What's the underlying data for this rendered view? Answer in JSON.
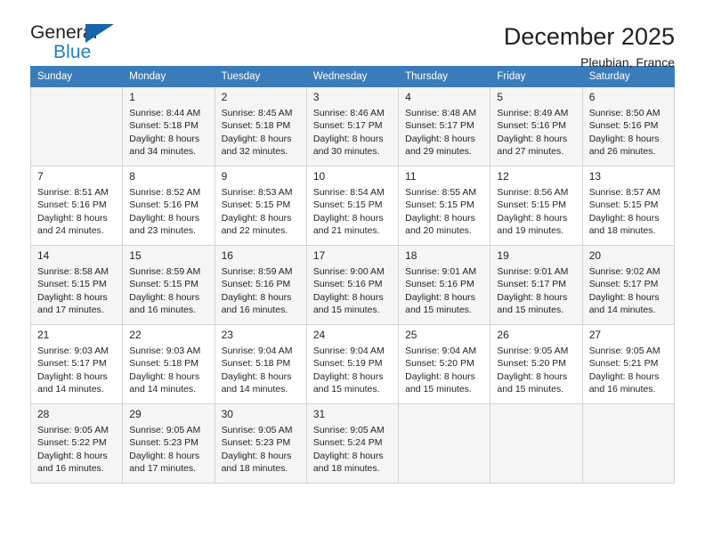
{
  "brand": {
    "name_part1": "General",
    "name_part2": "Blue",
    "triangle_icon": "triangle-icon",
    "accent_color": "#1f7fc4",
    "triangle_color": "#1565a8"
  },
  "header": {
    "title": "December 2025",
    "subtitle": "Pleubian, France"
  },
  "calendar": {
    "header_bg": "#3a7cb9",
    "header_text_color": "#ffffff",
    "shaded_row_bg": "#f5f5f5",
    "weekday_labels": [
      "Sunday",
      "Monday",
      "Tuesday",
      "Wednesday",
      "Thursday",
      "Friday",
      "Saturday"
    ],
    "weeks": [
      {
        "shaded": true,
        "days": [
          {
            "num": "",
            "sunrise": "",
            "sunset": "",
            "daylight_line1": "",
            "daylight_line2": ""
          },
          {
            "num": "1",
            "sunrise": "Sunrise: 8:44 AM",
            "sunset": "Sunset: 5:18 PM",
            "daylight_line1": "Daylight: 8 hours",
            "daylight_line2": "and 34 minutes."
          },
          {
            "num": "2",
            "sunrise": "Sunrise: 8:45 AM",
            "sunset": "Sunset: 5:18 PM",
            "daylight_line1": "Daylight: 8 hours",
            "daylight_line2": "and 32 minutes."
          },
          {
            "num": "3",
            "sunrise": "Sunrise: 8:46 AM",
            "sunset": "Sunset: 5:17 PM",
            "daylight_line1": "Daylight: 8 hours",
            "daylight_line2": "and 30 minutes."
          },
          {
            "num": "4",
            "sunrise": "Sunrise: 8:48 AM",
            "sunset": "Sunset: 5:17 PM",
            "daylight_line1": "Daylight: 8 hours",
            "daylight_line2": "and 29 minutes."
          },
          {
            "num": "5",
            "sunrise": "Sunrise: 8:49 AM",
            "sunset": "Sunset: 5:16 PM",
            "daylight_line1": "Daylight: 8 hours",
            "daylight_line2": "and 27 minutes."
          },
          {
            "num": "6",
            "sunrise": "Sunrise: 8:50 AM",
            "sunset": "Sunset: 5:16 PM",
            "daylight_line1": "Daylight: 8 hours",
            "daylight_line2": "and 26 minutes."
          }
        ]
      },
      {
        "shaded": false,
        "days": [
          {
            "num": "7",
            "sunrise": "Sunrise: 8:51 AM",
            "sunset": "Sunset: 5:16 PM",
            "daylight_line1": "Daylight: 8 hours",
            "daylight_line2": "and 24 minutes."
          },
          {
            "num": "8",
            "sunrise": "Sunrise: 8:52 AM",
            "sunset": "Sunset: 5:16 PM",
            "daylight_line1": "Daylight: 8 hours",
            "daylight_line2": "and 23 minutes."
          },
          {
            "num": "9",
            "sunrise": "Sunrise: 8:53 AM",
            "sunset": "Sunset: 5:15 PM",
            "daylight_line1": "Daylight: 8 hours",
            "daylight_line2": "and 22 minutes."
          },
          {
            "num": "10",
            "sunrise": "Sunrise: 8:54 AM",
            "sunset": "Sunset: 5:15 PM",
            "daylight_line1": "Daylight: 8 hours",
            "daylight_line2": "and 21 minutes."
          },
          {
            "num": "11",
            "sunrise": "Sunrise: 8:55 AM",
            "sunset": "Sunset: 5:15 PM",
            "daylight_line1": "Daylight: 8 hours",
            "daylight_line2": "and 20 minutes."
          },
          {
            "num": "12",
            "sunrise": "Sunrise: 8:56 AM",
            "sunset": "Sunset: 5:15 PM",
            "daylight_line1": "Daylight: 8 hours",
            "daylight_line2": "and 19 minutes."
          },
          {
            "num": "13",
            "sunrise": "Sunrise: 8:57 AM",
            "sunset": "Sunset: 5:15 PM",
            "daylight_line1": "Daylight: 8 hours",
            "daylight_line2": "and 18 minutes."
          }
        ]
      },
      {
        "shaded": true,
        "days": [
          {
            "num": "14",
            "sunrise": "Sunrise: 8:58 AM",
            "sunset": "Sunset: 5:15 PM",
            "daylight_line1": "Daylight: 8 hours",
            "daylight_line2": "and 17 minutes."
          },
          {
            "num": "15",
            "sunrise": "Sunrise: 8:59 AM",
            "sunset": "Sunset: 5:15 PM",
            "daylight_line1": "Daylight: 8 hours",
            "daylight_line2": "and 16 minutes."
          },
          {
            "num": "16",
            "sunrise": "Sunrise: 8:59 AM",
            "sunset": "Sunset: 5:16 PM",
            "daylight_line1": "Daylight: 8 hours",
            "daylight_line2": "and 16 minutes."
          },
          {
            "num": "17",
            "sunrise": "Sunrise: 9:00 AM",
            "sunset": "Sunset: 5:16 PM",
            "daylight_line1": "Daylight: 8 hours",
            "daylight_line2": "and 15 minutes."
          },
          {
            "num": "18",
            "sunrise": "Sunrise: 9:01 AM",
            "sunset": "Sunset: 5:16 PM",
            "daylight_line1": "Daylight: 8 hours",
            "daylight_line2": "and 15 minutes."
          },
          {
            "num": "19",
            "sunrise": "Sunrise: 9:01 AM",
            "sunset": "Sunset: 5:17 PM",
            "daylight_line1": "Daylight: 8 hours",
            "daylight_line2": "and 15 minutes."
          },
          {
            "num": "20",
            "sunrise": "Sunrise: 9:02 AM",
            "sunset": "Sunset: 5:17 PM",
            "daylight_line1": "Daylight: 8 hours",
            "daylight_line2": "and 14 minutes."
          }
        ]
      },
      {
        "shaded": false,
        "days": [
          {
            "num": "21",
            "sunrise": "Sunrise: 9:03 AM",
            "sunset": "Sunset: 5:17 PM",
            "daylight_line1": "Daylight: 8 hours",
            "daylight_line2": "and 14 minutes."
          },
          {
            "num": "22",
            "sunrise": "Sunrise: 9:03 AM",
            "sunset": "Sunset: 5:18 PM",
            "daylight_line1": "Daylight: 8 hours",
            "daylight_line2": "and 14 minutes."
          },
          {
            "num": "23",
            "sunrise": "Sunrise: 9:04 AM",
            "sunset": "Sunset: 5:18 PM",
            "daylight_line1": "Daylight: 8 hours",
            "daylight_line2": "and 14 minutes."
          },
          {
            "num": "24",
            "sunrise": "Sunrise: 9:04 AM",
            "sunset": "Sunset: 5:19 PM",
            "daylight_line1": "Daylight: 8 hours",
            "daylight_line2": "and 15 minutes."
          },
          {
            "num": "25",
            "sunrise": "Sunrise: 9:04 AM",
            "sunset": "Sunset: 5:20 PM",
            "daylight_line1": "Daylight: 8 hours",
            "daylight_line2": "and 15 minutes."
          },
          {
            "num": "26",
            "sunrise": "Sunrise: 9:05 AM",
            "sunset": "Sunset: 5:20 PM",
            "daylight_line1": "Daylight: 8 hours",
            "daylight_line2": "and 15 minutes."
          },
          {
            "num": "27",
            "sunrise": "Sunrise: 9:05 AM",
            "sunset": "Sunset: 5:21 PM",
            "daylight_line1": "Daylight: 8 hours",
            "daylight_line2": "and 16 minutes."
          }
        ]
      },
      {
        "shaded": true,
        "days": [
          {
            "num": "28",
            "sunrise": "Sunrise: 9:05 AM",
            "sunset": "Sunset: 5:22 PM",
            "daylight_line1": "Daylight: 8 hours",
            "daylight_line2": "and 16 minutes."
          },
          {
            "num": "29",
            "sunrise": "Sunrise: 9:05 AM",
            "sunset": "Sunset: 5:23 PM",
            "daylight_line1": "Daylight: 8 hours",
            "daylight_line2": "and 17 minutes."
          },
          {
            "num": "30",
            "sunrise": "Sunrise: 9:05 AM",
            "sunset": "Sunset: 5:23 PM",
            "daylight_line1": "Daylight: 8 hours",
            "daylight_line2": "and 18 minutes."
          },
          {
            "num": "31",
            "sunrise": "Sunrise: 9:05 AM",
            "sunset": "Sunset: 5:24 PM",
            "daylight_line1": "Daylight: 8 hours",
            "daylight_line2": "and 18 minutes."
          },
          {
            "num": "",
            "sunrise": "",
            "sunset": "",
            "daylight_line1": "",
            "daylight_line2": ""
          },
          {
            "num": "",
            "sunrise": "",
            "sunset": "",
            "daylight_line1": "",
            "daylight_line2": ""
          },
          {
            "num": "",
            "sunrise": "",
            "sunset": "",
            "daylight_line1": "",
            "daylight_line2": ""
          }
        ]
      }
    ]
  }
}
